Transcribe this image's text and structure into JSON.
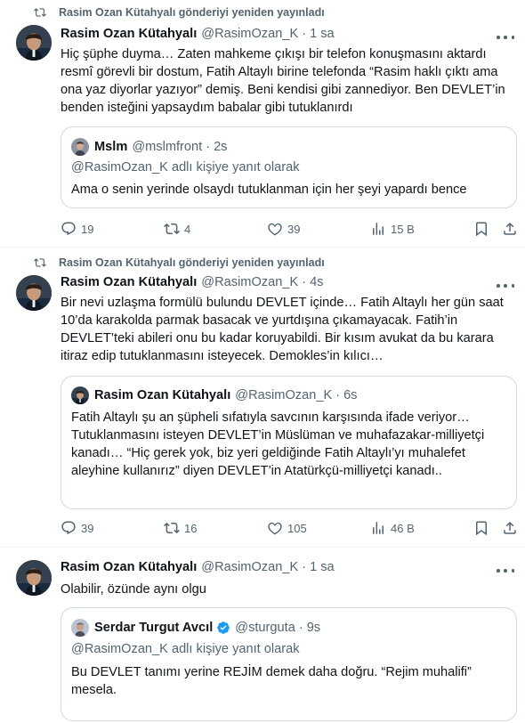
{
  "posts": [
    {
      "repost_label": "Rasim Ozan Kütahyalı gönderiyi yeniden yayınladı",
      "author": "Rasim Ozan Kütahyalı",
      "handle": "@RasimOzan_K",
      "time": "1 sa",
      "text": "Hiç şüphe duyma… Zaten mahkeme çıkışı bir telefon konuşmasını aktardı resmî görevli bir dostum, Fatih Altaylı birine telefonda “Rasim haklı çıktı ama ona yaz diyorlar yazıyor” demiş. Beni kendisi gibi zannediyor. Ben DEVLET’in benden isteğini yapsaydım babalar gibi tutuklanırdı",
      "quote": {
        "author": "Mslm",
        "handle": "@mslmfront",
        "time": "2s",
        "reply_label": "@RasimOzan_K adlı kişiye yanıt olarak",
        "text": "Ama o senin yerinde olsaydı tutuklanman için her şeyi yapardı bence"
      },
      "replies": "19",
      "reposts": "4",
      "likes": "39",
      "views": "15 B"
    },
    {
      "repost_label": "Rasim Ozan Kütahyalı gönderiyi yeniden yayınladı",
      "author": "Rasim Ozan Kütahyalı",
      "handle": "@RasimOzan_K",
      "time": "4s",
      "text": "Bir nevi uzlaşma formülü bulundu DEVLET içinde… Fatih Altaylı her gün saat 10’da karakolda parmak basacak ve yurtdışına çıkamayacak. Fatih’in DEVLET’teki abileri onu bu kadar koruyabildi. Bir kısım avukat da bu karara itiraz edip tutuklanmasını isteyecek. Demokles’in kılıcı…",
      "quote": {
        "author": "Rasim Ozan Kütahyalı",
        "handle": "@RasimOzan_K",
        "time": "6s",
        "text": "Fatih Altaylı şu an şüpheli sıfatıyla savcının karşısında ifade veriyor… Tutuklanmasını isteyen DEVLET’in Müslüman ve muhafazakar-milliyetçi kanadı… “Hiç gerek yok, biz yeri geldiğinde Fatih Altaylı’yı muhalefet aleyhine kullanırız” diyen DEVLET’in Atatürkçü-milliyetçi kanadı.."
      },
      "replies": "39",
      "reposts": "16",
      "likes": "105",
      "views": "46 B"
    },
    {
      "author": "Rasim Ozan Kütahyalı",
      "handle": "@RasimOzan_K",
      "time": "1 sa",
      "text": "Olabilir, özünde aynı olgu",
      "quote": {
        "author": "Serdar Turgut Avcıl",
        "handle": "@sturguta",
        "time": "9s",
        "reply_label": "@RasimOzan_K adlı kişiye yanıt olarak",
        "text": "Bu DEVLET tanımı yerine REJİM demek daha doğru. “Rejim muhalifi” mesela."
      }
    }
  ],
  "colors": {
    "text": "#0f1419",
    "muted": "#536471",
    "border": "#cfd9de",
    "verified": "#1d9bf0"
  },
  "icons": [
    "repost-icon",
    "more-icon",
    "reply-icon",
    "like-icon",
    "views-icon",
    "bookmark-icon",
    "share-icon",
    "verified-badge-icon"
  ]
}
